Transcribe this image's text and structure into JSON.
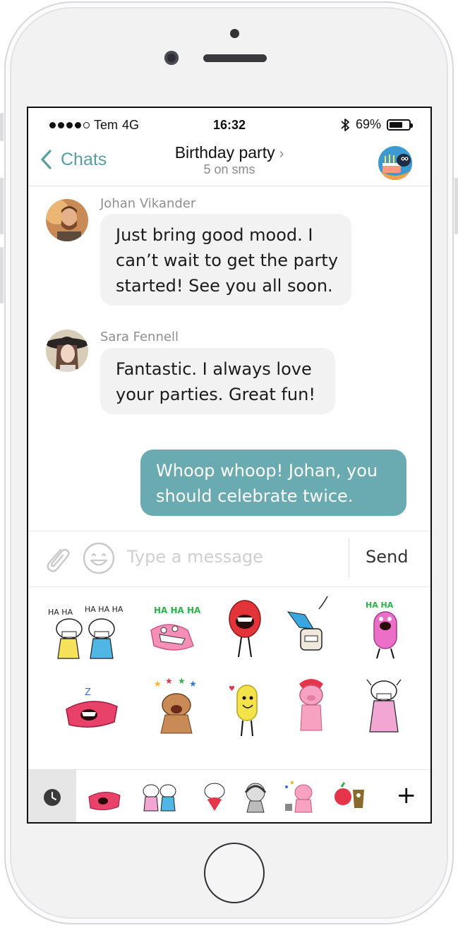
{
  "status": {
    "carrier": "Tem",
    "network": "4G",
    "time": "16:32",
    "battery": "69%",
    "battery_level": 0.69
  },
  "nav": {
    "back_label": "Chats",
    "title": "Birthday party",
    "subtitle": "5 on sms"
  },
  "messages": [
    {
      "sender": "Johan Vikander",
      "lines": [
        "Just bring good mood. I",
        "can’t wait to get the party",
        "started! See you all soon."
      ]
    },
    {
      "sender": "Sara Fennell",
      "lines": [
        "Fantastic. I always love",
        "your parties. Great fun!"
      ]
    },
    {
      "sender": "",
      "lines": [
        "Whoop whoop! Johan, you",
        "should celebrate twice."
      ]
    }
  ],
  "composer": {
    "placeholder": "Type a message",
    "send_label": "Send"
  },
  "stickers": {
    "ha1": "HA HA",
    "ha2": "HA HA HA",
    "ha3": "HA HA HA",
    "ha4": "HA HA",
    "zz": "Z"
  },
  "colors": {
    "accent": "#5a9ea0",
    "outgoing_bubble": "#6aaab1",
    "incoming_bubble": "#f2f2f2"
  }
}
